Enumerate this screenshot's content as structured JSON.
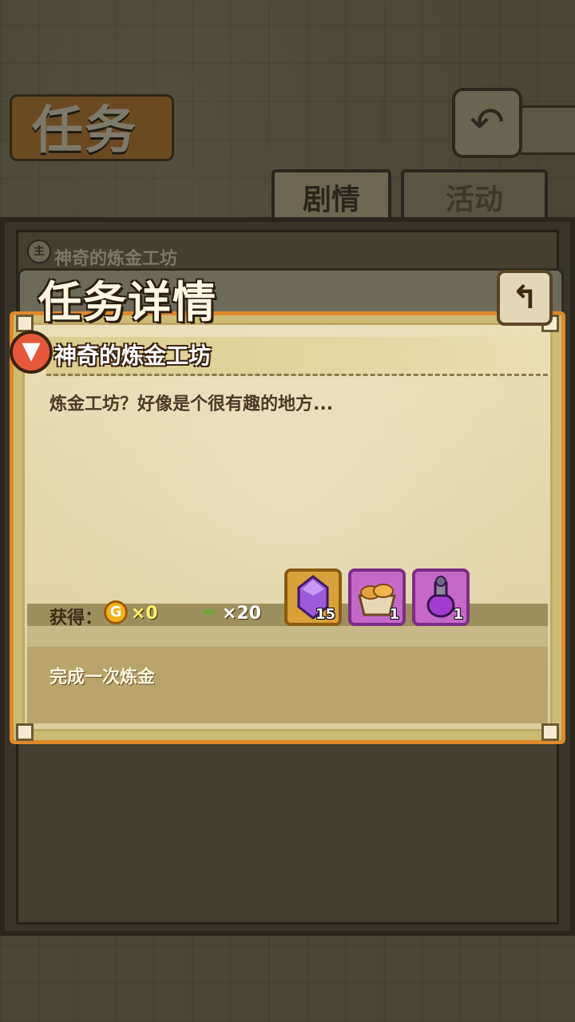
{
  "screen": {
    "title": "任务"
  },
  "tabs": [
    {
      "label": "剧情",
      "active": true
    },
    {
      "label": "活动",
      "active": false
    }
  ],
  "background_list": {
    "mission_title": "神奇的炼金工坊",
    "row_badge": "主"
  },
  "modal": {
    "title": "任务详情",
    "quest_title": "神奇的炼金工坊",
    "quest_marker_glyph": "▼",
    "description": "炼金工坊？好像是个很有趣的地方...",
    "reward_label": "获得：",
    "coin_glyph": "G",
    "coin_qty": "×0",
    "feather_qty": "×20",
    "items": [
      {
        "name": "purple-crystal",
        "qty": "15"
      },
      {
        "name": "bread-basket",
        "qty": "1"
      },
      {
        "name": "purple-vase",
        "qty": "1"
      }
    ],
    "condition": "完成一次炼金"
  },
  "icons": {
    "back": "back-arrow-icon",
    "close": "return-arrow-icon",
    "coin": "gold-coin-icon",
    "feather": "feather-icon"
  },
  "colors": {
    "modal_border": "#e08a2c",
    "coin": "#f1b21b",
    "coin_qty_text": "#fff36a",
    "rare_slot": "#d8a13a",
    "epic_slot": "#c569c9",
    "quest_marker": "#e7583a"
  }
}
